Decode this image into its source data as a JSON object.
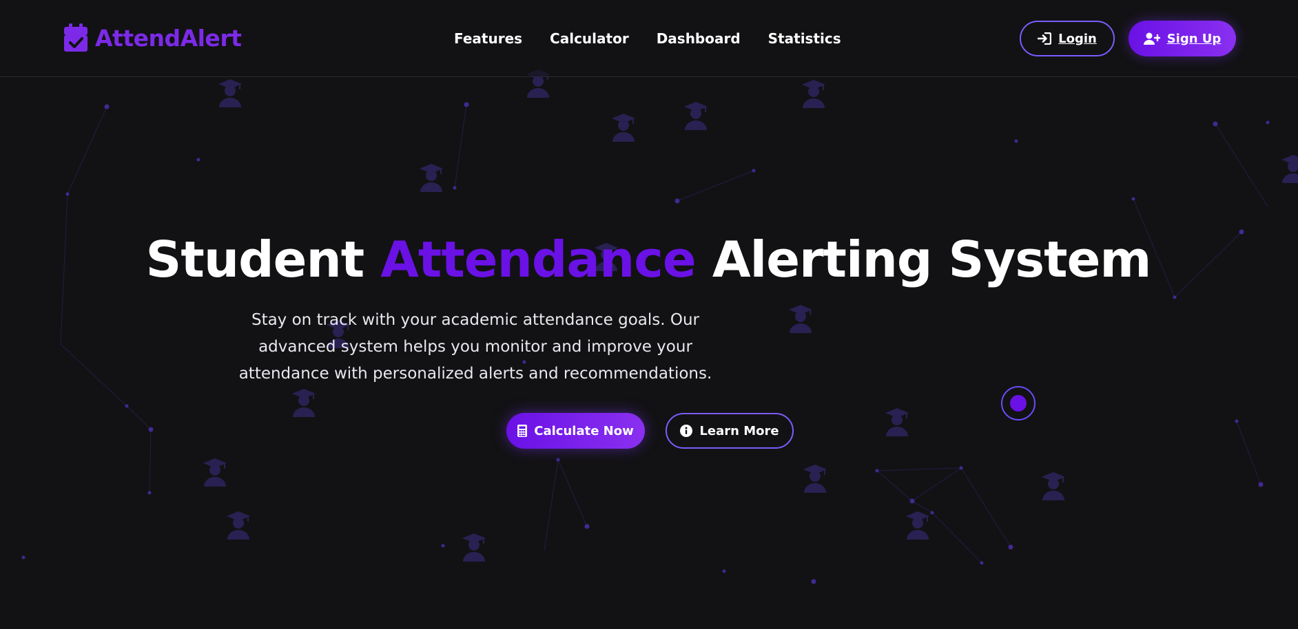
{
  "brand": {
    "name": "AttendAlert",
    "color": "#7c2ae8",
    "icon": "calendar-check-icon"
  },
  "nav": {
    "items": [
      "Features",
      "Calculator",
      "Dashboard",
      "Statistics"
    ]
  },
  "auth": {
    "login_label": "Login",
    "login_icon": "sign-in-icon",
    "signup_label": "Sign Up",
    "signup_icon": "user-plus-icon"
  },
  "hero": {
    "title_before": "Student ",
    "title_accent": "Attendance",
    "title_after": " Alerting System",
    "description": "Stay on track with your academic attendance goals. Our advanced system helps you monitor and improve your attendance with personalized alerts and recommendations.",
    "primary_button": "Calculate Now",
    "primary_icon": "calculator-icon",
    "secondary_button": "Learn More",
    "secondary_icon": "info-circle-icon"
  },
  "background": {
    "decoration_icon": "graduate-icon",
    "accent": "#6a11e6",
    "particle_color": "#4a2ea8"
  }
}
